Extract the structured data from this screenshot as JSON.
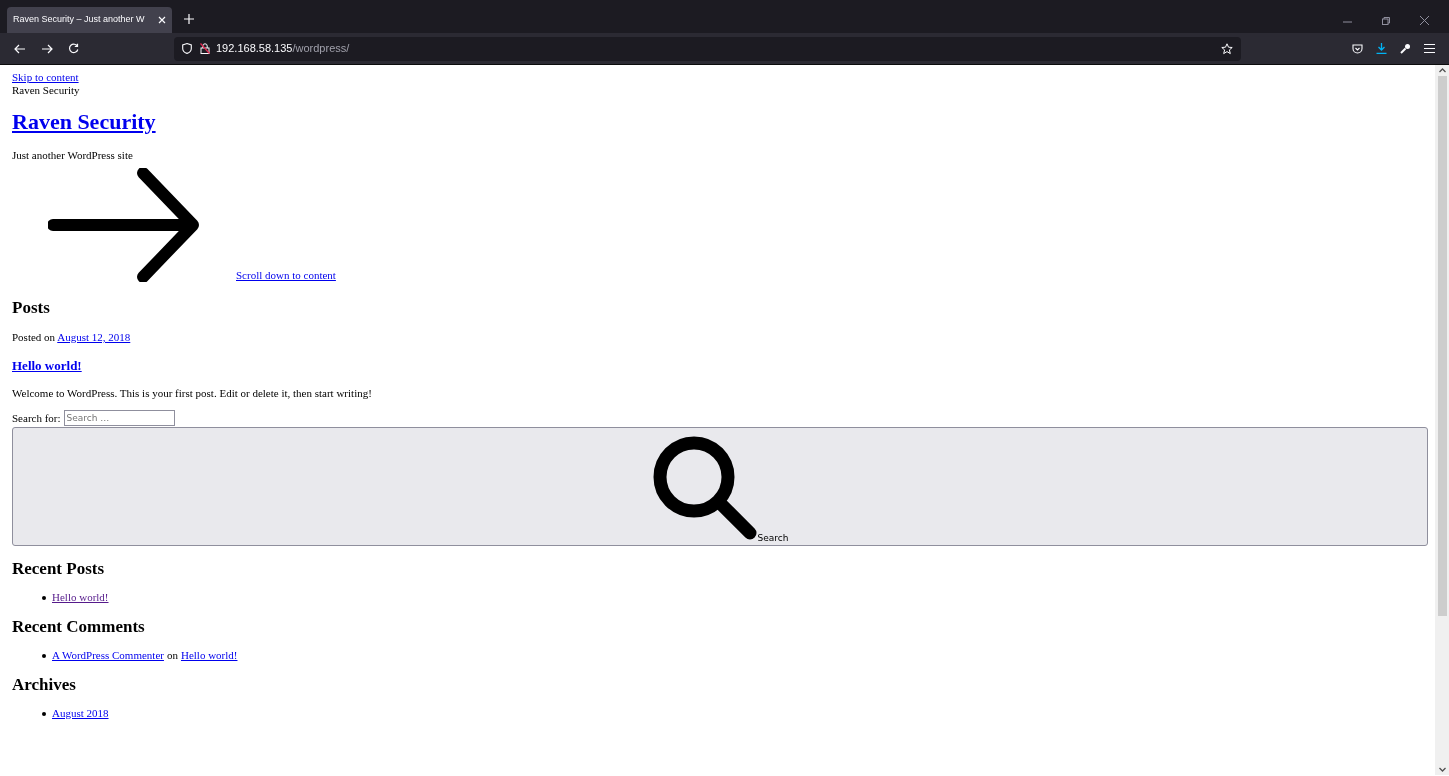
{
  "browser": {
    "tab": {
      "title": "Raven Security – Just another W",
      "selected": true
    },
    "url_host": "192.168.58.135",
    "url_path": "/wordpress/"
  },
  "page": {
    "skip_link": "Skip to content",
    "site_name_small": "Raven Security",
    "site_title": "Raven Security",
    "tagline": "Just another WordPress site",
    "scroll_link": "Scroll down to content",
    "posts_heading": "Posts",
    "post": {
      "posted_on": "Posted on",
      "date": "August 12, 2018",
      "title": "Hello world!",
      "excerpt": "Welcome to WordPress. This is your first post. Edit or delete it, then start writing!"
    },
    "search": {
      "label": "Search for:",
      "placeholder": "Search …",
      "button": "Search"
    },
    "widgets": [
      {
        "heading": "Recent Posts",
        "items": [
          [
            {
              "text": "Hello world!",
              "kind": "link",
              "visited": true
            }
          ]
        ]
      },
      {
        "heading": "Recent Comments",
        "items": [
          [
            {
              "text": "A WordPress Commenter",
              "kind": "link",
              "visited": false
            },
            {
              "text": "on",
              "kind": "text"
            },
            {
              "text": "Hello world!",
              "kind": "link",
              "visited": false
            }
          ]
        ]
      },
      {
        "heading": "Archives",
        "items": [
          [
            {
              "text": "August 2018",
              "kind": "link",
              "visited": false
            }
          ]
        ]
      }
    ]
  }
}
